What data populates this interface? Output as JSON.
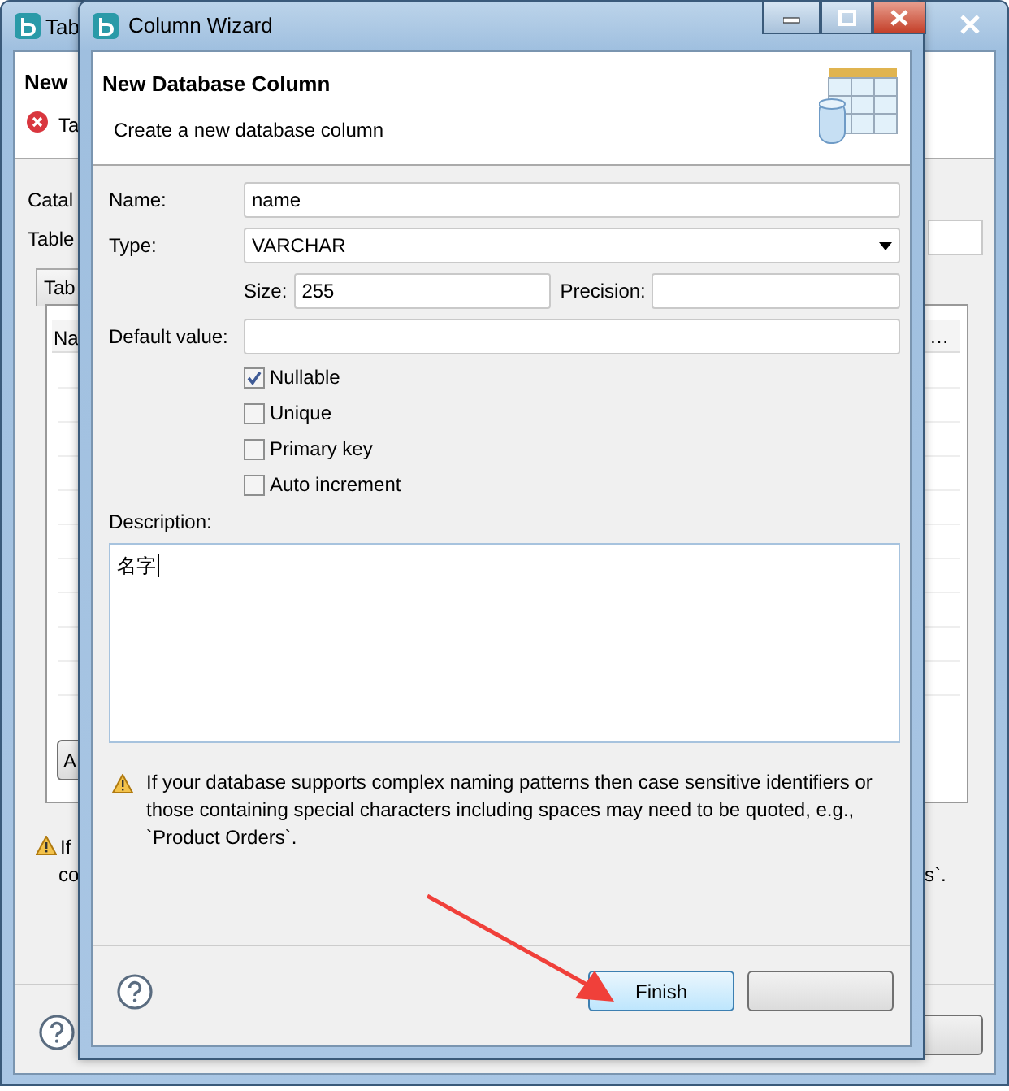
{
  "background_window": {
    "title": "Tab",
    "header_title": "New",
    "error_message": "Ta",
    "labels": [
      "Catal",
      "Table"
    ],
    "tab": "Tab",
    "column_header": "Na",
    "column_overflow": "…",
    "button": "A",
    "warning_lines": [
      "If",
      "co"
    ],
    "warning_end": "s`."
  },
  "dialog": {
    "title": "Column Wizard",
    "header_title": "New Database Column",
    "header_description": "Create a new database column",
    "name": {
      "label": "Name:",
      "value": "name"
    },
    "type": {
      "label": "Type:",
      "value": "VARCHAR"
    },
    "size": {
      "label": "Size:",
      "value": "255"
    },
    "precision": {
      "label": "Precision:"
    },
    "default_value": {
      "label": "Default value:"
    },
    "checkboxes": [
      {
        "label": "Nullable",
        "checked": true
      },
      {
        "label": "Unique",
        "checked": false
      },
      {
        "label": "Primary key",
        "checked": false
      },
      {
        "label": "Auto increment",
        "checked": false
      }
    ],
    "description": {
      "label": "Description:",
      "value": "名字"
    },
    "note": "If your database supports complex naming patterns then case sensitive identifiers or those containing special characters including spaces may need to be quoted, e.g., `Product Orders`.",
    "buttons": [
      {
        "label": "Finish",
        "kind": "default"
      }
    ]
  }
}
